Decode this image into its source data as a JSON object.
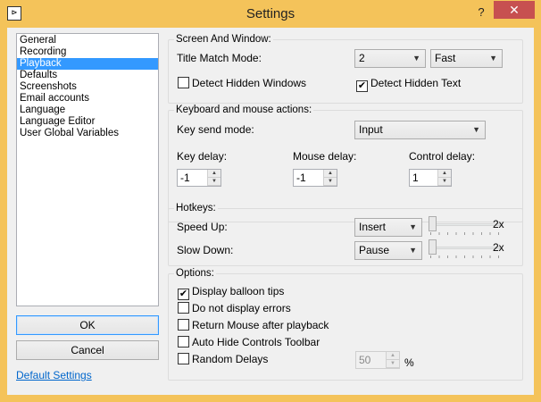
{
  "window": {
    "title": "Settings",
    "app_icon": "⊳",
    "help_symbol": "?",
    "close_symbol": "✕"
  },
  "sidebar": {
    "items": [
      "General",
      "Recording",
      "Playback",
      "Defaults",
      "Screenshots",
      "Email accounts",
      "Language",
      "Language Editor",
      "User Global Variables"
    ],
    "selected": "Playback",
    "ok_label": "OK",
    "cancel_label": "Cancel",
    "default_settings_label": "Default Settings"
  },
  "screen_window": {
    "title": "Screen And Window:",
    "title_match_mode_label": "Title Match Mode:",
    "title_match_mode_value": "2",
    "match_speed_value": "Fast",
    "detect_hidden_windows_label": "Detect Hidden Windows",
    "detect_hidden_windows_checked": false,
    "detect_hidden_text_label": "Detect Hidden Text",
    "detect_hidden_text_checked": true
  },
  "keyboard_mouse": {
    "title": "Keyboard and mouse actions:",
    "key_send_mode_label": "Key send mode:",
    "key_send_mode_value": "Input",
    "key_delay_label": "Key delay:",
    "key_delay_value": "-1",
    "mouse_delay_label": "Mouse delay:",
    "mouse_delay_value": "-1",
    "control_delay_label": "Control delay:",
    "control_delay_value": "1"
  },
  "hotkeys": {
    "title": "Hotkeys:",
    "speed_up_label": "Speed Up:",
    "speed_up_value": "Insert",
    "speed_up_multiplier": "2x",
    "slow_down_label": "Slow Down:",
    "slow_down_value": "Pause",
    "slow_down_multiplier": "2x"
  },
  "options": {
    "title": "Options:",
    "display_balloon_tips_label": "Display balloon tips",
    "display_balloon_tips_checked": true,
    "do_not_display_errors_label": "Do not display errors",
    "do_not_display_errors_checked": false,
    "return_mouse_label": "Return Mouse after playback",
    "return_mouse_checked": false,
    "auto_hide_toolbar_label": "Auto Hide Controls Toolbar",
    "auto_hide_toolbar_checked": false,
    "random_delays_label": "Random Delays",
    "random_delays_checked": false,
    "random_delays_value": "50",
    "random_delays_unit": "%"
  },
  "icons": {
    "check": "✔",
    "dropdown": "▼",
    "spin_up": "▲",
    "spin_down": "▼"
  },
  "colors": {
    "title_bar": "#f4c35a",
    "close_button": "#c75050",
    "selection": "#3399ff",
    "link": "#0066cc"
  }
}
